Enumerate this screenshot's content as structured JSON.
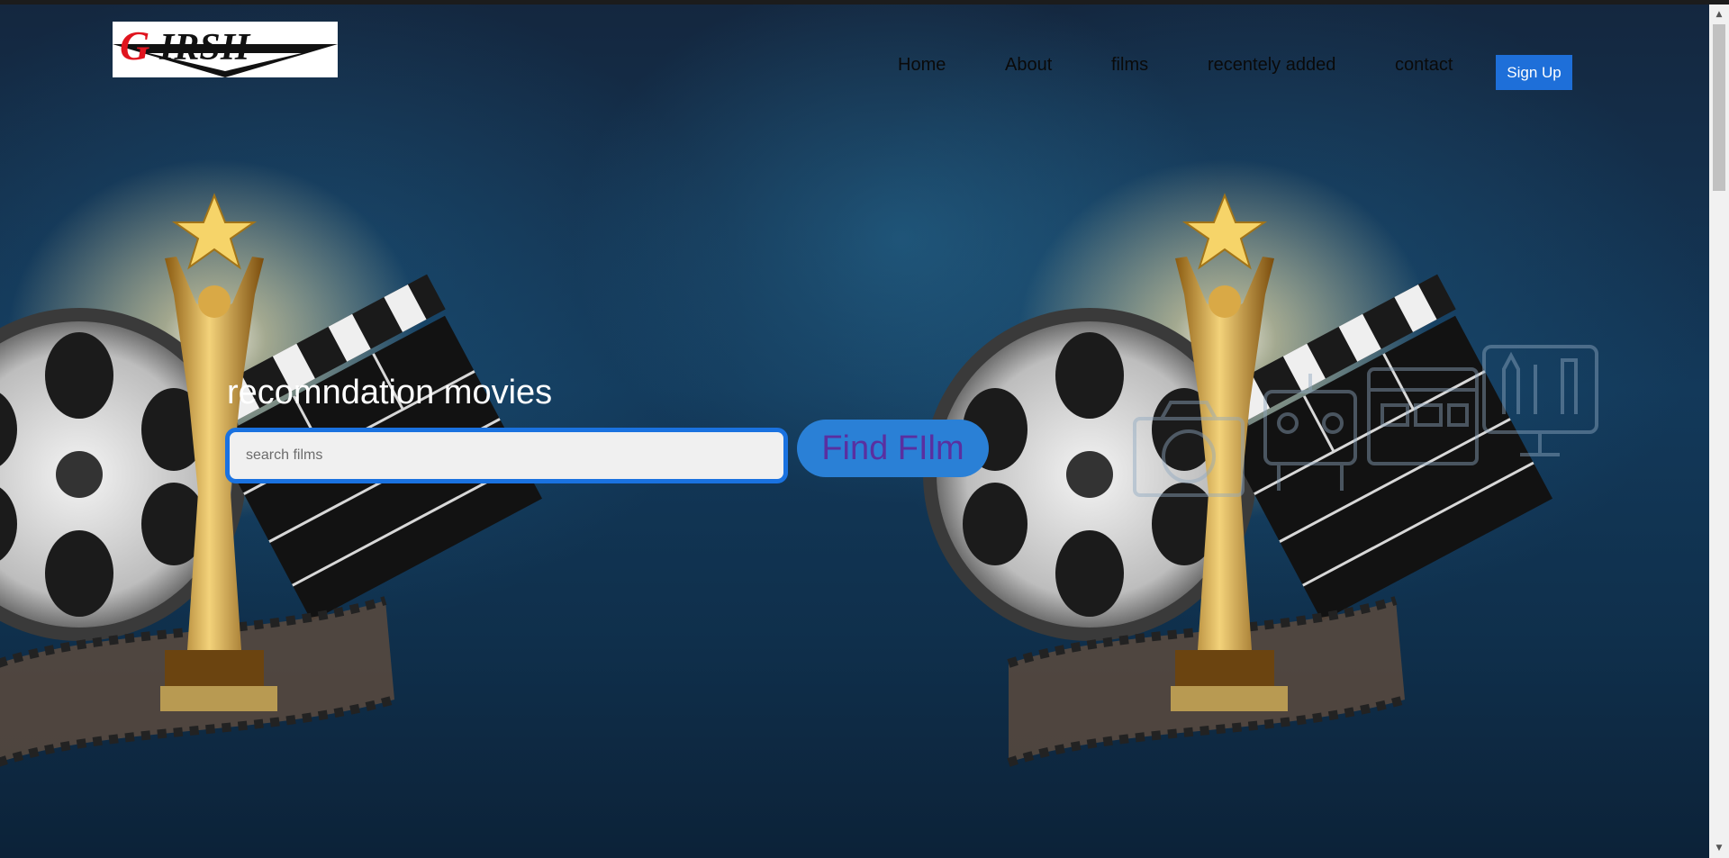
{
  "header": {
    "logo_text": "GIRSH",
    "nav": [
      {
        "label": "Home"
      },
      {
        "label": "About"
      },
      {
        "label": "films"
      },
      {
        "label": "recentely added"
      },
      {
        "label": "contact"
      }
    ],
    "signup_label": "Sign Up"
  },
  "hero": {
    "title": "recomndation movies",
    "search": {
      "placeholder": "search films",
      "value": ""
    },
    "find_button_label": "Find FIlm"
  },
  "colors": {
    "accent": "#1e6fd9",
    "find_button_bg": "#2a80d6",
    "find_button_text": "#5a2fa0",
    "logo_red": "#e0141e"
  },
  "icons": [
    "camera-icon",
    "robot-icon",
    "web-layout-icon",
    "design-tools-monitor-icon"
  ]
}
